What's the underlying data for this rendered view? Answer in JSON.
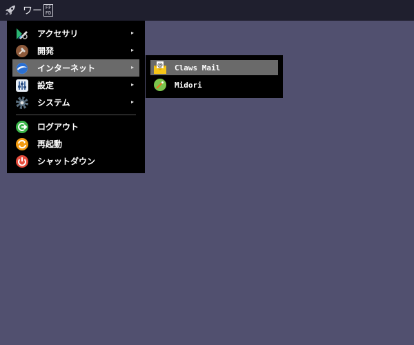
{
  "taskbar": {
    "launcher_icon": "rocket-icon",
    "workspace_label": "ワー",
    "workspace_box": "FFFD"
  },
  "menu": {
    "items": [
      {
        "label": "アクセサリ",
        "icon": "accessories-icon",
        "has_submenu": true
      },
      {
        "label": "開発",
        "icon": "development-icon",
        "has_submenu": true
      },
      {
        "label": "インターネット",
        "icon": "internet-icon",
        "has_submenu": true,
        "active": true
      },
      {
        "label": "設定",
        "icon": "settings-icon",
        "has_submenu": true
      },
      {
        "label": "システム",
        "icon": "system-icon",
        "has_submenu": true
      },
      {
        "label": "ログアウト",
        "icon": "logout-icon",
        "has_submenu": false
      },
      {
        "label": "再起動",
        "icon": "reboot-icon",
        "has_submenu": false
      },
      {
        "label": "シャットダウン",
        "icon": "shutdown-icon",
        "has_submenu": false
      }
    ],
    "arrow": "▸"
  },
  "submenu": {
    "items": [
      {
        "label": "Claws Mail",
        "icon": "mail-icon",
        "active": true
      },
      {
        "label": "Midori",
        "icon": "browser-icon"
      }
    ]
  },
  "colors": {
    "desktop": "#51506f",
    "taskbar": "#1f1f2e",
    "menu_bg": "#000000",
    "highlight": "#6a6a6a"
  }
}
